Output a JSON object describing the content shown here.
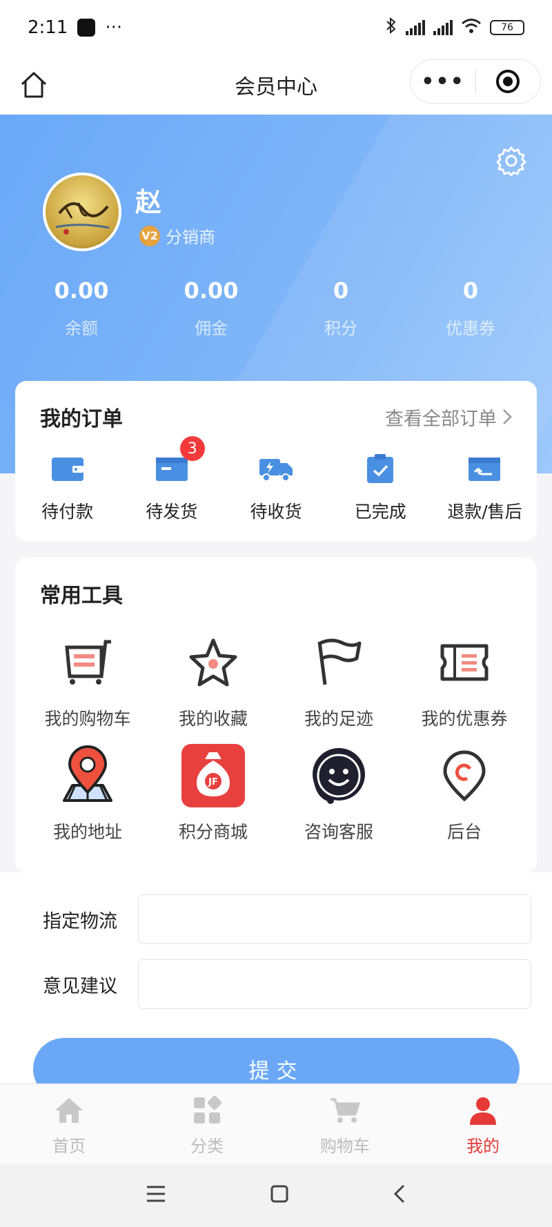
{
  "status_bar": {
    "time": "2:11",
    "dots": "···",
    "battery": "76"
  },
  "header": {
    "title": "会员中心",
    "more": "•••"
  },
  "profile": {
    "name": "赵",
    "level_badge": "V2",
    "role": "分销商"
  },
  "stats": [
    {
      "value": "0.00",
      "label": "余额"
    },
    {
      "value": "0.00",
      "label": "佣金"
    },
    {
      "value": "0",
      "label": "积分"
    },
    {
      "value": "0",
      "label": "优惠券"
    }
  ],
  "orders": {
    "title": "我的订单",
    "view_all": "查看全部订单",
    "items": [
      {
        "label": "待付款",
        "icon": "wallet-icon"
      },
      {
        "label": "待发货",
        "icon": "box-icon",
        "badge": "3"
      },
      {
        "label": "待收货",
        "icon": "truck-icon"
      },
      {
        "label": "已完成",
        "icon": "clipboard-check-icon"
      },
      {
        "label": "退款/售后",
        "icon": "return-icon"
      }
    ]
  },
  "tools": {
    "title": "常用工具",
    "items": [
      {
        "label": "我的购物车",
        "icon": "cart-icon"
      },
      {
        "label": "我的收藏",
        "icon": "star-icon"
      },
      {
        "label": "我的足迹",
        "icon": "flag-icon"
      },
      {
        "label": "我的优惠券",
        "icon": "ticket-icon"
      },
      {
        "label": "我的地址",
        "icon": "map-pin-icon"
      },
      {
        "label": "积分商城",
        "icon": "money-bag-icon"
      },
      {
        "label": "咨询客服",
        "icon": "customer-service-icon"
      },
      {
        "label": "后台",
        "icon": "admin-pin-icon"
      }
    ]
  },
  "form": {
    "logistics_label": "指定物流",
    "logistics_value": "",
    "feedback_label": "意见建议",
    "feedback_value": "",
    "submit_label": "提交"
  },
  "tabbar": {
    "active_color": "#e53935",
    "items": [
      {
        "label": "首页",
        "icon": "home-icon"
      },
      {
        "label": "分类",
        "icon": "category-icon"
      },
      {
        "label": "购物车",
        "icon": "cart-icon"
      },
      {
        "label": "我的",
        "icon": "user-icon"
      }
    ]
  },
  "colors": {
    "primary": "#6aa8f7",
    "badge": "#f23a3a",
    "accent_red": "#e53935"
  }
}
